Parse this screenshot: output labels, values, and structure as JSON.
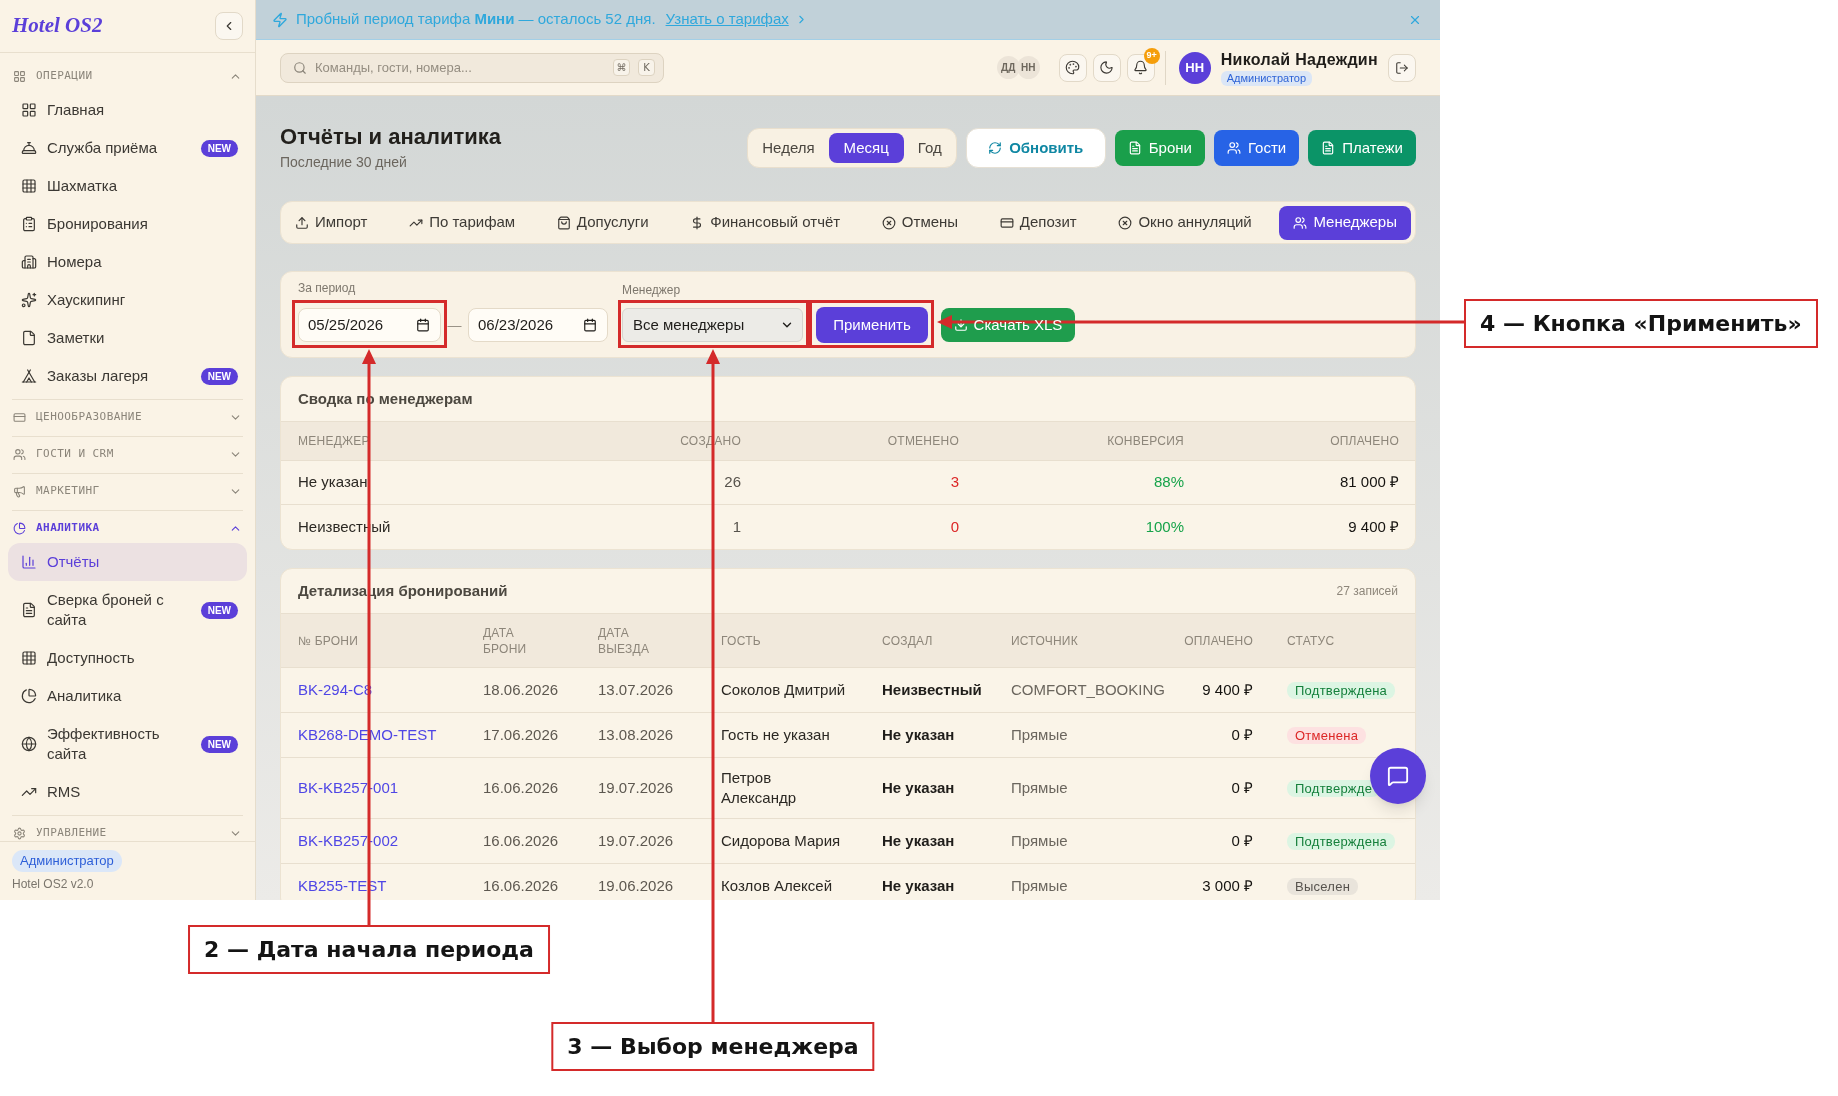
{
  "sidebar": {
    "logo": "Hotel OS2",
    "sections": [
      {
        "title": "ОПЕРАЦИИ",
        "expanded": true,
        "active": false,
        "items": [
          {
            "label": "Главная",
            "selected": false
          },
          {
            "label": "Служба приёма",
            "badge": "NEW",
            "selected": false
          },
          {
            "label": "Шахматка",
            "selected": false
          },
          {
            "label": "Бронирования",
            "selected": false
          },
          {
            "label": "Номера",
            "selected": false
          },
          {
            "label": "Хаускипинг",
            "selected": false
          },
          {
            "label": "Заметки",
            "selected": false
          },
          {
            "label": "Заказы лагеря",
            "badge": "NEW",
            "selected": false
          }
        ]
      },
      {
        "title": "ЦЕНООБРАЗОВАНИЕ",
        "expanded": false,
        "active": false
      },
      {
        "title": "ГОСТИ И CRM",
        "expanded": false,
        "active": false
      },
      {
        "title": "МАРКЕТИНГ",
        "expanded": false,
        "active": false
      },
      {
        "title": "АНАЛИТИКА",
        "expanded": true,
        "active": true,
        "items": [
          {
            "label": "Отчёты",
            "selected": true
          },
          {
            "label": "Сверка броней с сайта",
            "badge": "NEW",
            "selected": false
          },
          {
            "label": "Доступность",
            "selected": false
          },
          {
            "label": "Аналитика",
            "selected": false
          },
          {
            "label": "Эффективность сайта",
            "badge": "NEW",
            "selected": false
          },
          {
            "label": "RMS",
            "selected": false
          }
        ]
      },
      {
        "title": "УПРАВЛЕНИЕ",
        "expanded": false,
        "active": false
      }
    ],
    "footer": {
      "role": "Администратор",
      "version": "Hotel OS2 v2.0"
    }
  },
  "banner": {
    "text": "Пробный период тарифа **Мини** — осталось 52 дня.",
    "link": "Узнать о тарифах"
  },
  "topbar": {
    "search": {
      "placeholder": "Команды, гости, номера...",
      "keys": [
        "⌘",
        "K"
      ]
    },
    "presence": [
      "ДД",
      "НН"
    ],
    "notifications": "9+",
    "user": {
      "initials": "НН",
      "name": "Николай Надеждин",
      "role": "Администратор"
    }
  },
  "header": {
    "title": "Отчёты и аналитика",
    "subtitle": "Последние 30 дней",
    "periods": [
      {
        "label": "Неделя",
        "selected": false
      },
      {
        "label": "Месяц",
        "selected": true
      },
      {
        "label": "Год",
        "selected": false
      }
    ],
    "refresh": "Обновить",
    "actions": [
      {
        "label": "Брони",
        "color": "#1a9f4b"
      },
      {
        "label": "Гости",
        "color": "#2763e6"
      },
      {
        "label": "Платежи",
        "color": "#0b9467"
      }
    ]
  },
  "tabs": [
    {
      "label": "Импорт",
      "selected": false
    },
    {
      "label": "По тарифам",
      "selected": false
    },
    {
      "label": "Допуслуги",
      "selected": false
    },
    {
      "label": "Финансовый отчёт",
      "selected": false
    },
    {
      "label": "Отмены",
      "selected": false
    },
    {
      "label": "Депозит",
      "selected": false
    },
    {
      "label": "Окно аннуляций",
      "selected": false
    },
    {
      "label": "Менеджеры",
      "selected": true
    }
  ],
  "filter": {
    "period_label": "За период",
    "date_from": "05/25/2026",
    "date_separator": "—",
    "date_to": "06/23/2026",
    "manager_label": "Менеджер",
    "manager": "Все менеджеры",
    "apply": "Применить",
    "export": "Скачать XLS"
  },
  "summary": {
    "title": "Сводка по менеджерам",
    "columns": [
      "МЕНЕДЖЕР",
      "СОЗДАНО",
      "ОТМЕНЕНО",
      "КОНВЕРСИЯ",
      "ОПЛАЧЕНО"
    ],
    "rows": [
      [
        "Не указан",
        "26",
        "3",
        "88%",
        "81 000 ₽"
      ],
      [
        "Неизвестный",
        "1",
        "0",
        "100%",
        "9 400 ₽"
      ]
    ]
  },
  "details": {
    "title": "Детализация бронирований",
    "count": "27 записей",
    "columns": [
      "№ БРОНИ",
      "ДАТА БРОНИ",
      "ДАТА ВЫЕЗДА",
      "ГОСТЬ",
      "СОЗДАЛ",
      "ИСТОЧНИК",
      "ОПЛАЧЕНО",
      "СТАТУС"
    ],
    "rows": [
      {
        "number": "BK-294-C8",
        "booked": "18.06.2026",
        "departure": "13.07.2026",
        "guest": "Соколов Дмитрий",
        "created_by": "Неизвестный",
        "source": "COMFORT_BOOKING",
        "paid": "9 400 ₽",
        "status": {
          "label": "Подтверждена",
          "kind": "confirmed"
        }
      },
      {
        "number": "KB268-DEMO-TEST",
        "booked": "17.06.2026",
        "departure": "13.08.2026",
        "guest": "Гость не указан",
        "created_by": "Не указан",
        "source": "Прямые",
        "paid": "0 ₽",
        "status": {
          "label": "Отменена",
          "kind": "cancelled"
        }
      },
      {
        "number": "BK-KB257-001",
        "booked": "16.06.2026",
        "departure": "19.07.2026",
        "guest": "Петров Александр",
        "created_by": "Не указан",
        "source": "Прямые",
        "paid": "0 ₽",
        "status": {
          "label": "Подтвержде",
          "kind": "confirmed"
        }
      },
      {
        "number": "BK-KB257-002",
        "booked": "16.06.2026",
        "departure": "19.07.2026",
        "guest": "Сидорова Мария",
        "created_by": "Не указан",
        "source": "Прямые",
        "paid": "0 ₽",
        "status": {
          "label": "Подтверждена",
          "kind": "confirmed"
        }
      },
      {
        "number": "KB255-TEST",
        "booked": "16.06.2026",
        "departure": "19.06.2026",
        "guest": "Козлов Алексей",
        "created_by": "Не указан",
        "source": "Прямые",
        "paid": "3 000 ₽",
        "status": {
          "label": "Выселен",
          "kind": "checked_out"
        }
      }
    ]
  },
  "annotations": [
    {
      "kind": "apply",
      "label": "4 — Кнопка «Применить»"
    },
    {
      "kind": "date_from",
      "label": "2 — Дата начала периода"
    },
    {
      "kind": "manager",
      "label": "3 — Выбор менеджера"
    }
  ]
}
